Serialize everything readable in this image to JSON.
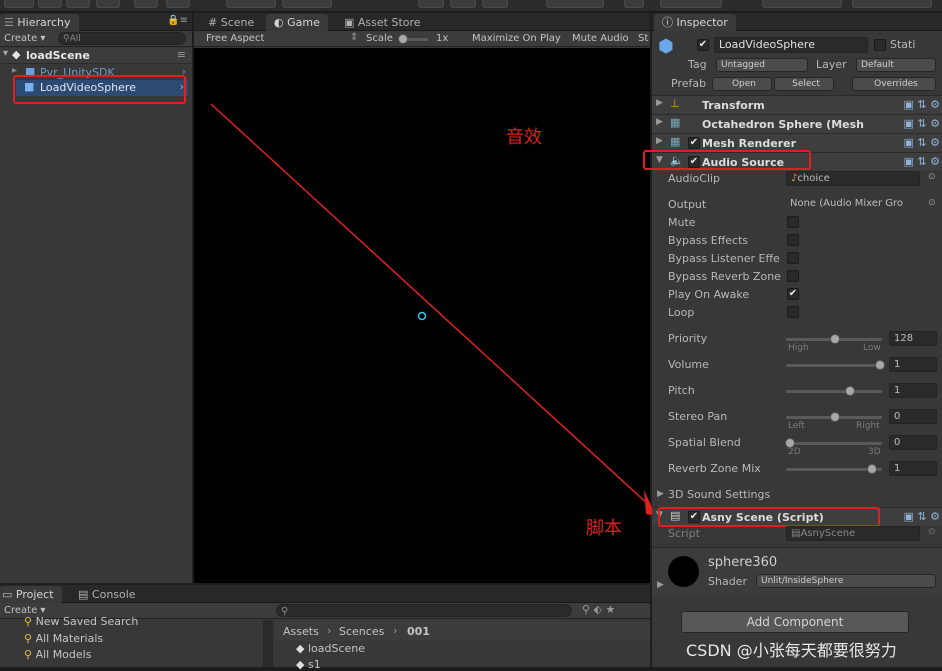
{
  "hierarchy": {
    "tab_label": "Hierarchy",
    "create_label": "Create",
    "search_placeholder": "All",
    "scene_name": "loadScene",
    "items": [
      "Pvr_UnitySDK",
      "LoadVideoSphere"
    ]
  },
  "center_tabs": [
    "Scene",
    "Game",
    "Asset Store"
  ],
  "game_toolbar": {
    "aspect": "Free Aspect",
    "scale_label": "Scale",
    "scale_value": "1x",
    "maximize": "Maximize On Play",
    "mute": "Mute Audio",
    "stats": "St"
  },
  "annotations": {
    "audio_label": "音效",
    "script_label": "脚本"
  },
  "inspector": {
    "tab_label": "Inspector",
    "object_name": "LoadVideoSphere",
    "static_label": "Stati",
    "tag_label": "Tag",
    "tag_value": "Untagged",
    "layer_label": "Layer",
    "layer_value": "Default",
    "prefab_label": "Prefab",
    "prefab_open": "Open",
    "prefab_select": "Select",
    "prefab_overrides": "Overrides",
    "components": [
      "Transform",
      "Octahedron Sphere (Mesh",
      "Mesh Renderer",
      "Audio Source"
    ],
    "audio": {
      "audioclip_label": "AudioClip",
      "audioclip_value": "choice",
      "output_label": "Output",
      "output_value": "None (Audio Mixer Gro",
      "mute_label": "Mute",
      "bypass_effects_label": "Bypass Effects",
      "bypass_listener_label": "Bypass Listener Effe",
      "bypass_reverb_label": "Bypass Reverb Zone",
      "play_on_awake_label": "Play On Awake",
      "loop_label": "Loop",
      "priority_label": "Priority",
      "priority_value": "128",
      "priority_high": "High",
      "priority_low": "Low",
      "volume_label": "Volume",
      "volume_value": "1",
      "pitch_label": "Pitch",
      "pitch_value": "1",
      "stereo_label": "Stereo Pan",
      "stereo_value": "0",
      "stereo_left": "Left",
      "stereo_right": "Right",
      "spatial_label": "Spatial Blend",
      "spatial_value": "0",
      "spatial_2d": "2D",
      "spatial_3d": "3D",
      "reverb_label": "Reverb Zone Mix",
      "reverb_value": "1",
      "sound3d_label": "3D Sound Settings"
    },
    "script_component": {
      "title": "Asny Scene (Script)",
      "script_label": "Script",
      "script_value": "AsnyScene"
    },
    "material": {
      "name": "sphere360",
      "shader_label": "Shader",
      "shader_value": "Unlit/InsideSphere"
    },
    "add_component": "Add Component"
  },
  "bottom": {
    "project_tab": "Project",
    "console_tab": "Console",
    "create_label": "Create",
    "favorites": [
      "New Saved Search",
      "All Materials",
      "All Models"
    ],
    "breadcrumb": [
      "Assets",
      "Scences",
      "001"
    ],
    "assets": [
      "loadScene",
      "s1"
    ]
  },
  "watermark": "CSDN @小张每天都要很努力",
  "colors": {
    "accent": "#3e6ea8",
    "annotation": "#e02020"
  }
}
